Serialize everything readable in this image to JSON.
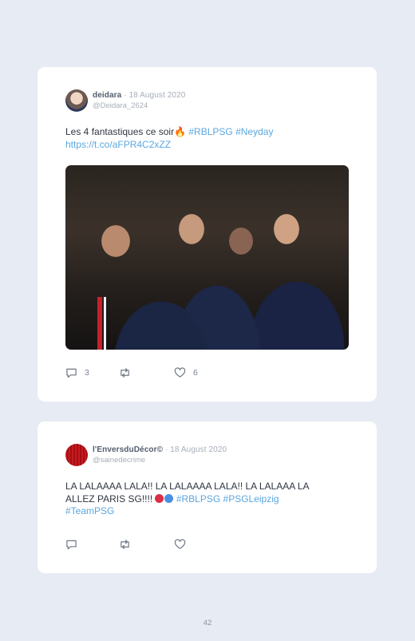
{
  "page_number": "42",
  "tweets": [
    {
      "display_name": "deidara",
      "date": "· 18 August 2020",
      "handle": "@Deidara_2624",
      "text_plain": "Les 4 fantastiques ce soir",
      "emoji": "🔥",
      "hashtags": [
        "#RBLPSG",
        "#Neyday"
      ],
      "link": "https://t.co/aFPR4C2xZZ",
      "image": "photo-psg-players-celebrating",
      "reply_count": "3",
      "like_count": "6"
    },
    {
      "display_name": "l'EnversduDécor©",
      "date": "· 18 August 2020",
      "handle": "@sainedecrime",
      "text_line1": "LA LALAAAA LALA!! LA LALAAAA LALA!! LA LALAAA LA",
      "text_line2_prefix": "ALLEZ PARIS SG!!!! ",
      "hashtags": [
        "#RBLPSG",
        "#PSGLeipzig",
        "#TeamPSG"
      ],
      "emoji_colors": [
        "#dc2e44",
        "#4a90e2"
      ],
      "reply_count": "",
      "like_count": ""
    }
  ],
  "colors": {
    "background": "#e7ebf3",
    "card": "#ffffff",
    "hashtag": "#5aa7e0",
    "text": "#2f3641"
  }
}
